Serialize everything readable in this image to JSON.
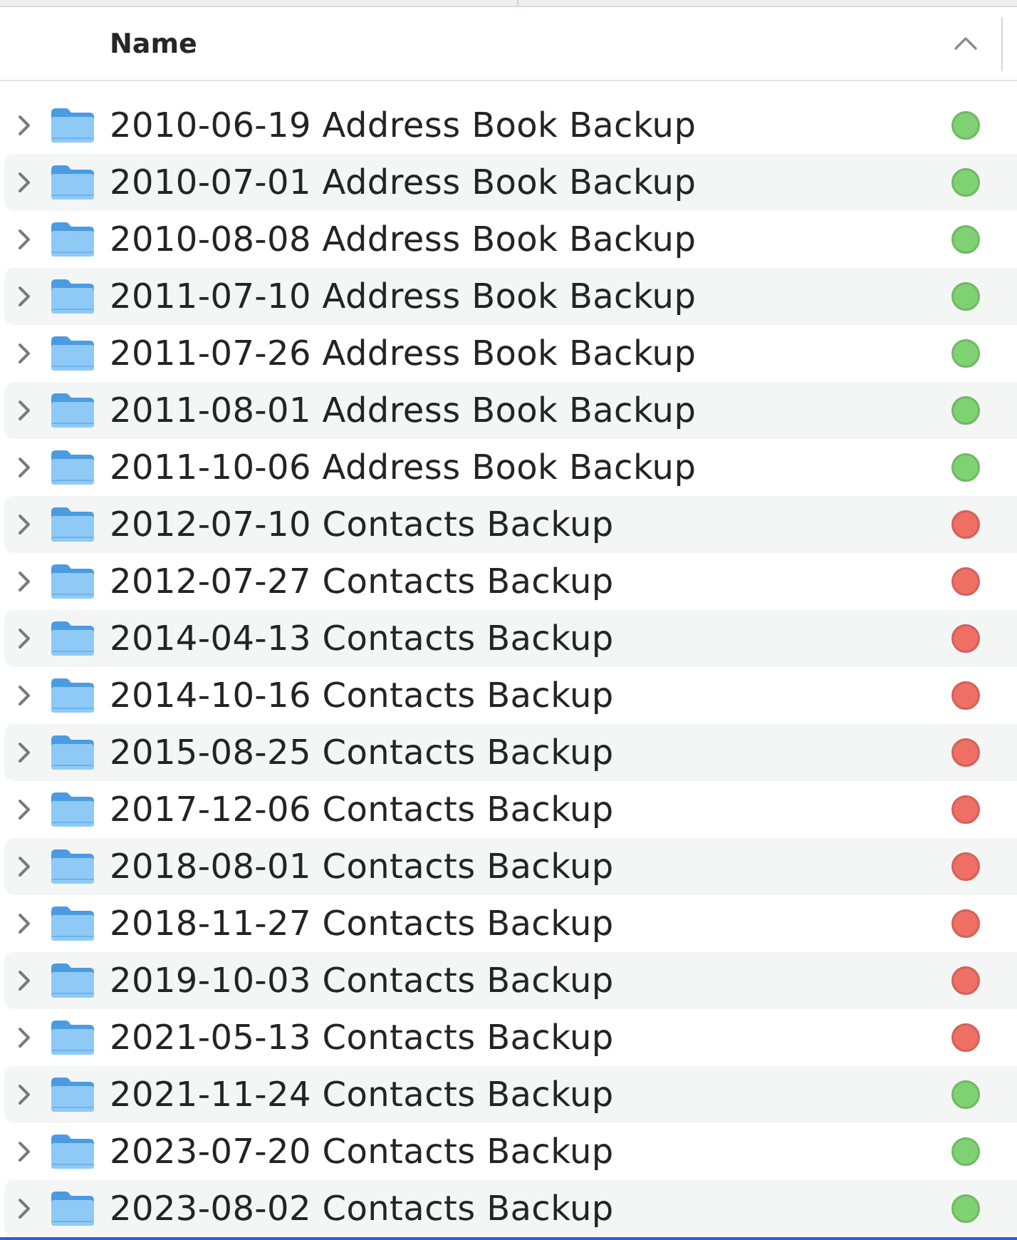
{
  "header": {
    "columns": [
      {
        "label": "Name",
        "sorted": true
      }
    ]
  },
  "rows": [
    {
      "name": "2010-06-19 Address Book Backup",
      "expanded": false,
      "color": "#7fd272"
    },
    {
      "name": "2010-07-01 Address Book Backup",
      "expanded": false,
      "color": "#7fd272"
    },
    {
      "name": "2010-08-08 Address Book Backup",
      "expanded": false,
      "color": "#7fd272"
    },
    {
      "name": "2011-07-10 Address Book Backup",
      "expanded": false,
      "color": "#7fd272"
    },
    {
      "name": "2011-07-26 Address Book Backup",
      "expanded": false,
      "color": "#7fd272"
    },
    {
      "name": "2011-08-01 Address Book Backup",
      "expanded": false,
      "color": "#7fd272"
    },
    {
      "name": "2011-10-06 Address Book Backup",
      "expanded": false,
      "color": "#7fd272"
    },
    {
      "name": "2012-07-10 Contacts Backup",
      "expanded": false,
      "color": "#ef6f64"
    },
    {
      "name": "2012-07-27 Contacts Backup",
      "expanded": false,
      "color": "#ef6f64"
    },
    {
      "name": "2014-04-13 Contacts Backup",
      "expanded": false,
      "color": "#ef6f64"
    },
    {
      "name": "2014-10-16 Contacts Backup",
      "expanded": false,
      "color": "#ef6f64"
    },
    {
      "name": "2015-08-25 Contacts Backup",
      "expanded": false,
      "color": "#ef6f64"
    },
    {
      "name": "2017-12-06 Contacts Backup",
      "expanded": false,
      "color": "#ef6f64"
    },
    {
      "name": "2018-08-01 Contacts Backup",
      "expanded": false,
      "color": "#ef6f64"
    },
    {
      "name": "2018-11-27 Contacts Backup",
      "expanded": false,
      "color": "#ef6f64"
    },
    {
      "name": "2019-10-03 Contacts Backup",
      "expanded": false,
      "color": "#ef6f64"
    },
    {
      "name": "2021-05-13 Contacts Backup",
      "expanded": false,
      "color": "#ef6f64"
    },
    {
      "name": "2021-11-24 Contacts Backup",
      "expanded": false,
      "color": "#7fd272"
    },
    {
      "name": "2023-07-20 Contacts Backup",
      "expanded": false,
      "color": "#7fd272"
    },
    {
      "name": "2023-08-02 Contacts Backup",
      "expanded": false,
      "color": "#7fd272"
    }
  ]
}
